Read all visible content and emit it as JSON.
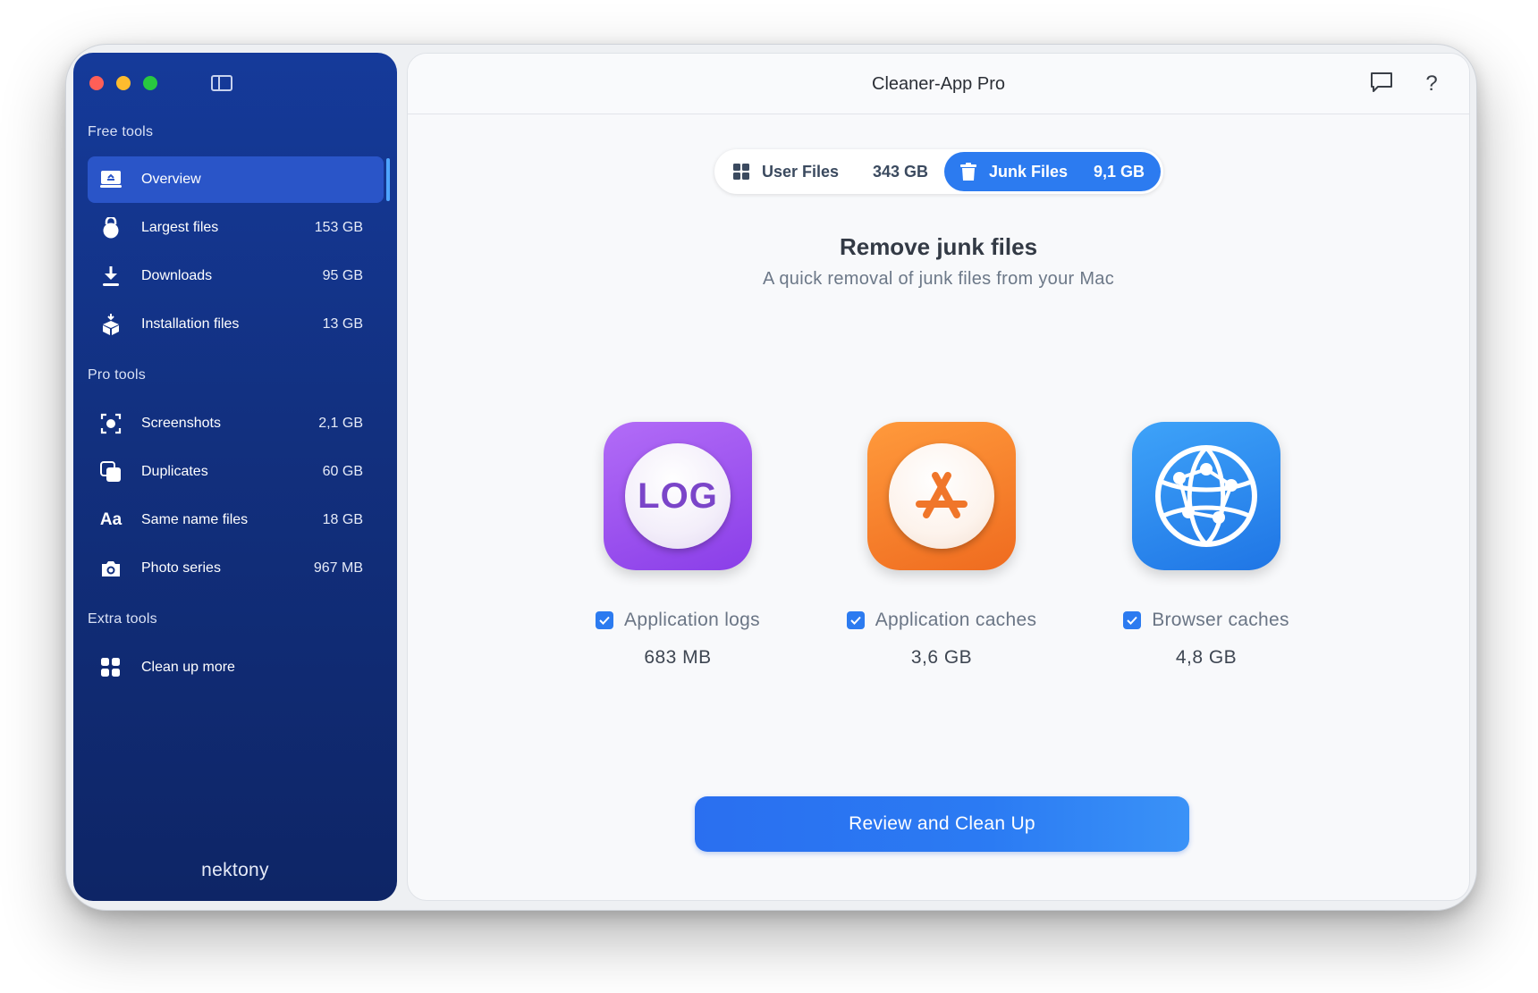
{
  "window": {
    "title": "Cleaner-App Pro"
  },
  "sidebar": {
    "sections": {
      "free": "Free tools",
      "pro": "Pro tools",
      "extra": "Extra tools"
    },
    "items": [
      {
        "label": "Overview",
        "value": "",
        "icon": "overview-icon"
      },
      {
        "label": "Largest files",
        "value": "153 GB",
        "icon": "kettlebell-icon"
      },
      {
        "label": "Downloads",
        "value": "95 GB",
        "icon": "download-icon"
      },
      {
        "label": "Installation files",
        "value": "13 GB",
        "icon": "package-icon"
      },
      {
        "label": "Screenshots",
        "value": "2,1 GB",
        "icon": "screenshot-icon"
      },
      {
        "label": "Duplicates",
        "value": "60 GB",
        "icon": "duplicates-icon"
      },
      {
        "label": "Same name files",
        "value": "18 GB",
        "icon": "text-aa-icon"
      },
      {
        "label": "Photo series",
        "value": "967 MB",
        "icon": "camera-icon"
      },
      {
        "label": "Clean up more",
        "value": "",
        "icon": "grid-icon"
      }
    ],
    "aa_glyph": "Aa",
    "brand": "nektony"
  },
  "tabs": {
    "user": {
      "label": "User Files",
      "value": "343 GB"
    },
    "junk": {
      "label": "Junk Files",
      "value": "9,1 GB"
    }
  },
  "content": {
    "title": "Remove junk files",
    "subtitle": "A quick removal of junk files from your Mac",
    "cards": [
      {
        "label": "Application logs",
        "size": "683 MB",
        "icon_text": "LOG",
        "icon": "log-icon",
        "checked": true
      },
      {
        "label": "Application caches",
        "size": "3,6 GB",
        "icon": "app-store-icon",
        "checked": true
      },
      {
        "label": "Browser caches",
        "size": "4,8 GB",
        "icon": "globe-network-icon",
        "checked": true
      }
    ],
    "cta_label": "Review and Clean Up"
  },
  "help_glyph": "?",
  "colors": {
    "accent": "#2c7bf0",
    "sidebar": "#153a9a",
    "logs": "#9a4ef0",
    "caches": "#f57d2c",
    "browser": "#2f8cf0"
  }
}
